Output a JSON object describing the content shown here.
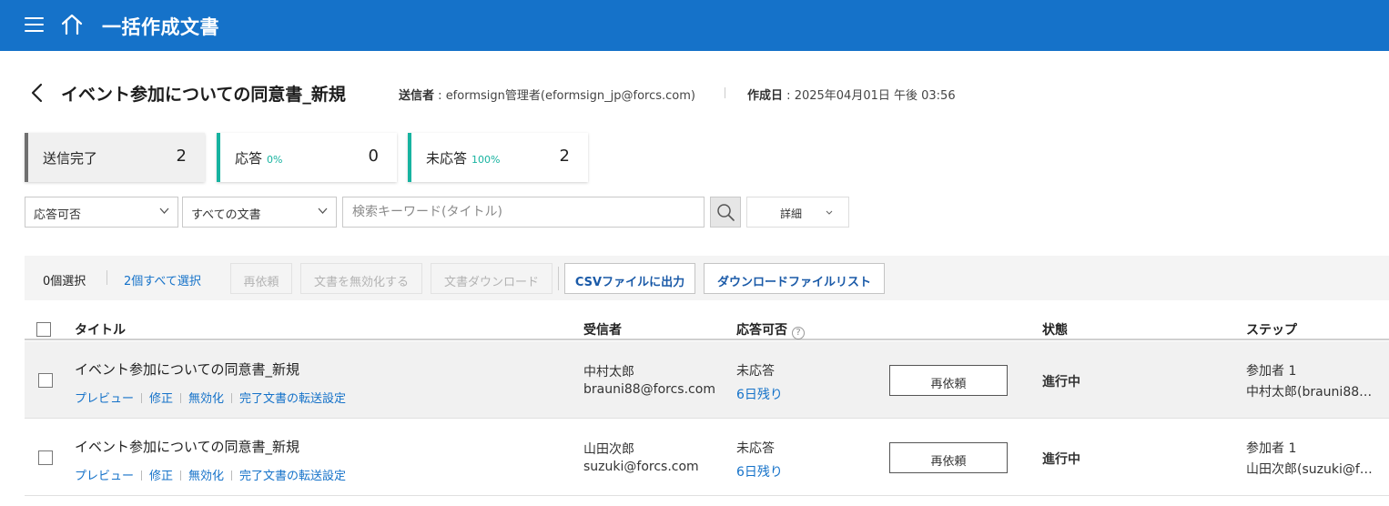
{
  "header": {
    "title": "一括作成文書"
  },
  "document": {
    "title": "イベント参加についての同意書_新規",
    "sender_label": "送信者",
    "sender_value": "eformsign管理者(eformsign_jp@forcs.com)",
    "created_label": "作成日",
    "created_value": "2025年04月01日 午後 03:56"
  },
  "stats": [
    {
      "label": "送信完了",
      "percent": "",
      "count": "2"
    },
    {
      "label": "応答",
      "percent": "0%",
      "count": "0"
    },
    {
      "label": "未応答",
      "percent": "100%",
      "count": "2"
    }
  ],
  "filters": {
    "response_select": "応答可否",
    "doc_select": "すべての文書",
    "search_placeholder": "検索キーワード(タイトル)",
    "detail_label": "詳細"
  },
  "toolbar": {
    "selected_count": "0個選択",
    "select_all": "2個すべて選択",
    "resend": "再依頼",
    "invalidate": "文書を無効化する",
    "download": "文書ダウンロード",
    "csv": "CSVファイルに出力",
    "download_list": "ダウンロードファイルリスト"
  },
  "table": {
    "columns": {
      "title": "タイトル",
      "recipient": "受信者",
      "response": "応答可否",
      "status": "状態",
      "step": "ステップ"
    },
    "help_glyph": "?",
    "rows": [
      {
        "title": "イベント参加についての同意書_新規",
        "actions": [
          "プレビュー",
          "修正",
          "無効化",
          "完了文書の転送設定"
        ],
        "recipient_name": "中村太郎",
        "recipient_email": "brauni88@forcs.com",
        "response_status": "未応答",
        "response_days": "6日残り",
        "resend": "再依頼",
        "state": "進行中",
        "step_name": "参加者 1",
        "step_person": "中村太郎(brauni88…"
      },
      {
        "title": "イベント参加についての同意書_新規",
        "actions": [
          "プレビュー",
          "修正",
          "無効化",
          "完了文書の転送設定"
        ],
        "recipient_name": "山田次郎",
        "recipient_email": "suzuki@forcs.com",
        "response_status": "未応答",
        "response_days": "6日残り",
        "resend": "再依頼",
        "state": "進行中",
        "step_name": "参加者 1",
        "step_person": "山田次郎(suzuki@f…"
      }
    ]
  },
  "colors": {
    "brand": "#1572c9",
    "accent_teal": "#17b3a0",
    "stat_bar_gray": "#707070"
  }
}
